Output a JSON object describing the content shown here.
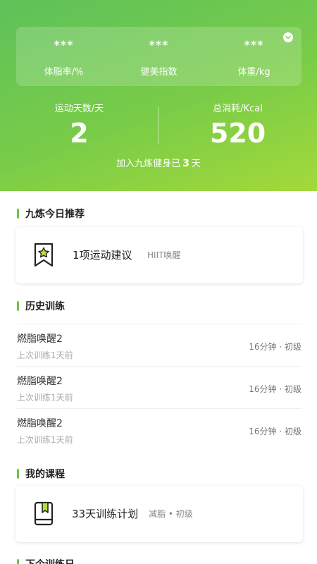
{
  "summary": {
    "metrics": [
      {
        "value": "***",
        "label": "体脂率/%"
      },
      {
        "value": "***",
        "label": "健美指数"
      },
      {
        "value": "***",
        "label": "体重/kg"
      }
    ],
    "exercise_days": {
      "label": "运动天数/天",
      "value": "2"
    },
    "total_calories": {
      "label": "总消耗/Kcal",
      "value": "520"
    },
    "joined": {
      "prefix": "加入九炼健身已",
      "days": "3",
      "suffix": "天"
    }
  },
  "today": {
    "title": "九炼今日推荐",
    "card": {
      "main": "1项运动建议",
      "sub": "HIIT唤醒"
    }
  },
  "history": {
    "title": "历史训练",
    "items": [
      {
        "title": "燃脂唤醒2",
        "subtitle": "上次训练1天前",
        "meta": "16分钟 · 初级"
      },
      {
        "title": "燃脂唤醒2",
        "subtitle": "上次训练1天前",
        "meta": "16分钟 · 初级"
      },
      {
        "title": "燃脂唤醒2",
        "subtitle": "上次训练1天前",
        "meta": "16分钟 · 初级"
      }
    ]
  },
  "courses": {
    "title": "我的课程",
    "card": {
      "main": "33天训练计划",
      "sub": "减脂 • 初级"
    }
  },
  "next_section": {
    "title": "下个训练日"
  },
  "colors": {
    "accent": "#6fc548",
    "gradient_start": "#5ec15a",
    "gradient_end": "#a4d93a"
  }
}
